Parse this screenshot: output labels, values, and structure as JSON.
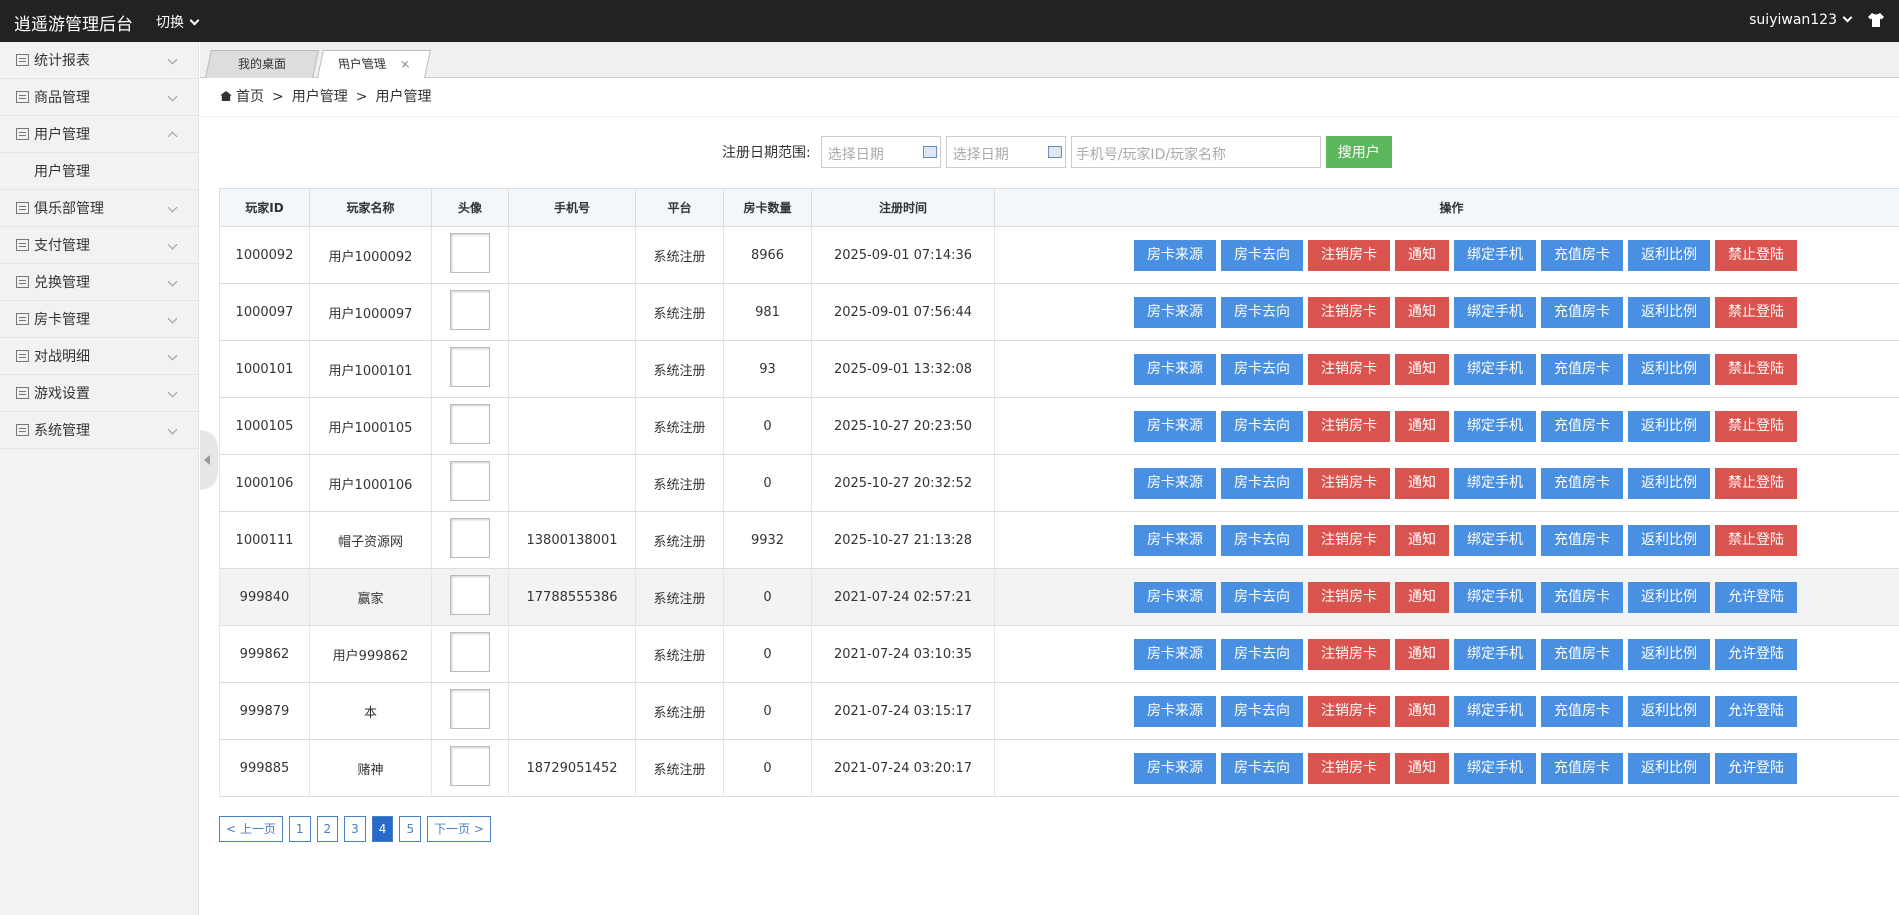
{
  "header": {
    "title": "逍遥游管理后台",
    "switch_label": "切换",
    "username": "suiyiwan123",
    "shirt_icon": "shirt-icon"
  },
  "sidebar": {
    "items": [
      {
        "label": "统计报表",
        "expanded": false
      },
      {
        "label": "商品管理",
        "expanded": false
      },
      {
        "label": "用户管理",
        "expanded": true,
        "sub": "用户管理"
      },
      {
        "label": "俱乐部管理",
        "expanded": false
      },
      {
        "label": "支付管理",
        "expanded": false
      },
      {
        "label": "兑换管理",
        "expanded": false
      },
      {
        "label": "房卡管理",
        "expanded": false
      },
      {
        "label": "对战明细",
        "expanded": false
      },
      {
        "label": "游戏设置",
        "expanded": false
      },
      {
        "label": "系统管理",
        "expanded": false
      }
    ]
  },
  "tabs": [
    {
      "label": "我的桌面",
      "active": false
    },
    {
      "label": "用户管理",
      "active": true,
      "close": "×"
    }
  ],
  "breadcrumb": {
    "home": "首页",
    "sep": ">",
    "level1": "用户管理",
    "level2": "用户管理"
  },
  "search": {
    "label": "注册日期范围:",
    "date_start_placeholder": "选择日期",
    "date_end_placeholder": "选择日期",
    "keyword_placeholder": "手机号/玩家ID/玩家名称",
    "button": "搜用户"
  },
  "table": {
    "headers": [
      "玩家ID",
      "玩家名称",
      "头像",
      "手机号",
      "平台",
      "房卡数量",
      "注册时间",
      "操作"
    ],
    "action_labels": {
      "source": "房卡来源",
      "dest": "房卡去向",
      "cancel": "注销房卡",
      "notify": "通知",
      "bind": "绑定手机",
      "recharge": "充值房卡",
      "rebate": "返利比例"
    },
    "rows": [
      {
        "id": "1000092",
        "name": "用户1000092",
        "phone": "",
        "platform": "系统注册",
        "cards": "8966",
        "time": "2025-09-01 07:14:36",
        "login": "禁止登陆",
        "login_color": "red",
        "gray": false
      },
      {
        "id": "1000097",
        "name": "用户1000097",
        "phone": "",
        "platform": "系统注册",
        "cards": "981",
        "time": "2025-09-01 07:56:44",
        "login": "禁止登陆",
        "login_color": "red",
        "gray": false
      },
      {
        "id": "1000101",
        "name": "用户1000101",
        "phone": "",
        "platform": "系统注册",
        "cards": "93",
        "time": "2025-09-01 13:32:08",
        "login": "禁止登陆",
        "login_color": "red",
        "gray": false
      },
      {
        "id": "1000105",
        "name": "用户1000105",
        "phone": "",
        "platform": "系统注册",
        "cards": "0",
        "time": "2025-10-27 20:23:50",
        "login": "禁止登陆",
        "login_color": "red",
        "gray": false
      },
      {
        "id": "1000106",
        "name": "用户1000106",
        "phone": "",
        "platform": "系统注册",
        "cards": "0",
        "time": "2025-10-27 20:32:52",
        "login": "禁止登陆",
        "login_color": "red",
        "gray": false
      },
      {
        "id": "1000111",
        "name": "帽子资源网",
        "phone": "13800138001",
        "platform": "系统注册",
        "cards": "9932",
        "time": "2025-10-27 21:13:28",
        "login": "禁止登陆",
        "login_color": "red",
        "gray": false
      },
      {
        "id": "999840",
        "name": "赢家",
        "phone": "17788555386",
        "platform": "系统注册",
        "cards": "0",
        "time": "2021-07-24 02:57:21",
        "login": "允许登陆",
        "login_color": "blue",
        "gray": true
      },
      {
        "id": "999862",
        "name": "用户999862",
        "phone": "",
        "platform": "系统注册",
        "cards": "0",
        "time": "2021-07-24 03:10:35",
        "login": "允许登陆",
        "login_color": "blue",
        "gray": false
      },
      {
        "id": "999879",
        "name": "本",
        "phone": "",
        "platform": "系统注册",
        "cards": "0",
        "time": "2021-07-24 03:15:17",
        "login": "允许登陆",
        "login_color": "blue",
        "gray": false
      },
      {
        "id": "999885",
        "name": "赌神",
        "phone": "18729051452",
        "platform": "系统注册",
        "cards": "0",
        "time": "2021-07-24 03:20:17",
        "login": "允许登陆",
        "login_color": "blue",
        "gray": false
      }
    ]
  },
  "pagination": {
    "prev": "< 上一页",
    "pages": [
      "1",
      "2",
      "3",
      "4",
      "5"
    ],
    "current": "4",
    "next": "下一页 >"
  },
  "colors": {
    "blue_btn": "#4a90e2",
    "red_btn": "#d9534f",
    "green_btn": "#5cb85c",
    "topbar": "#222222"
  }
}
